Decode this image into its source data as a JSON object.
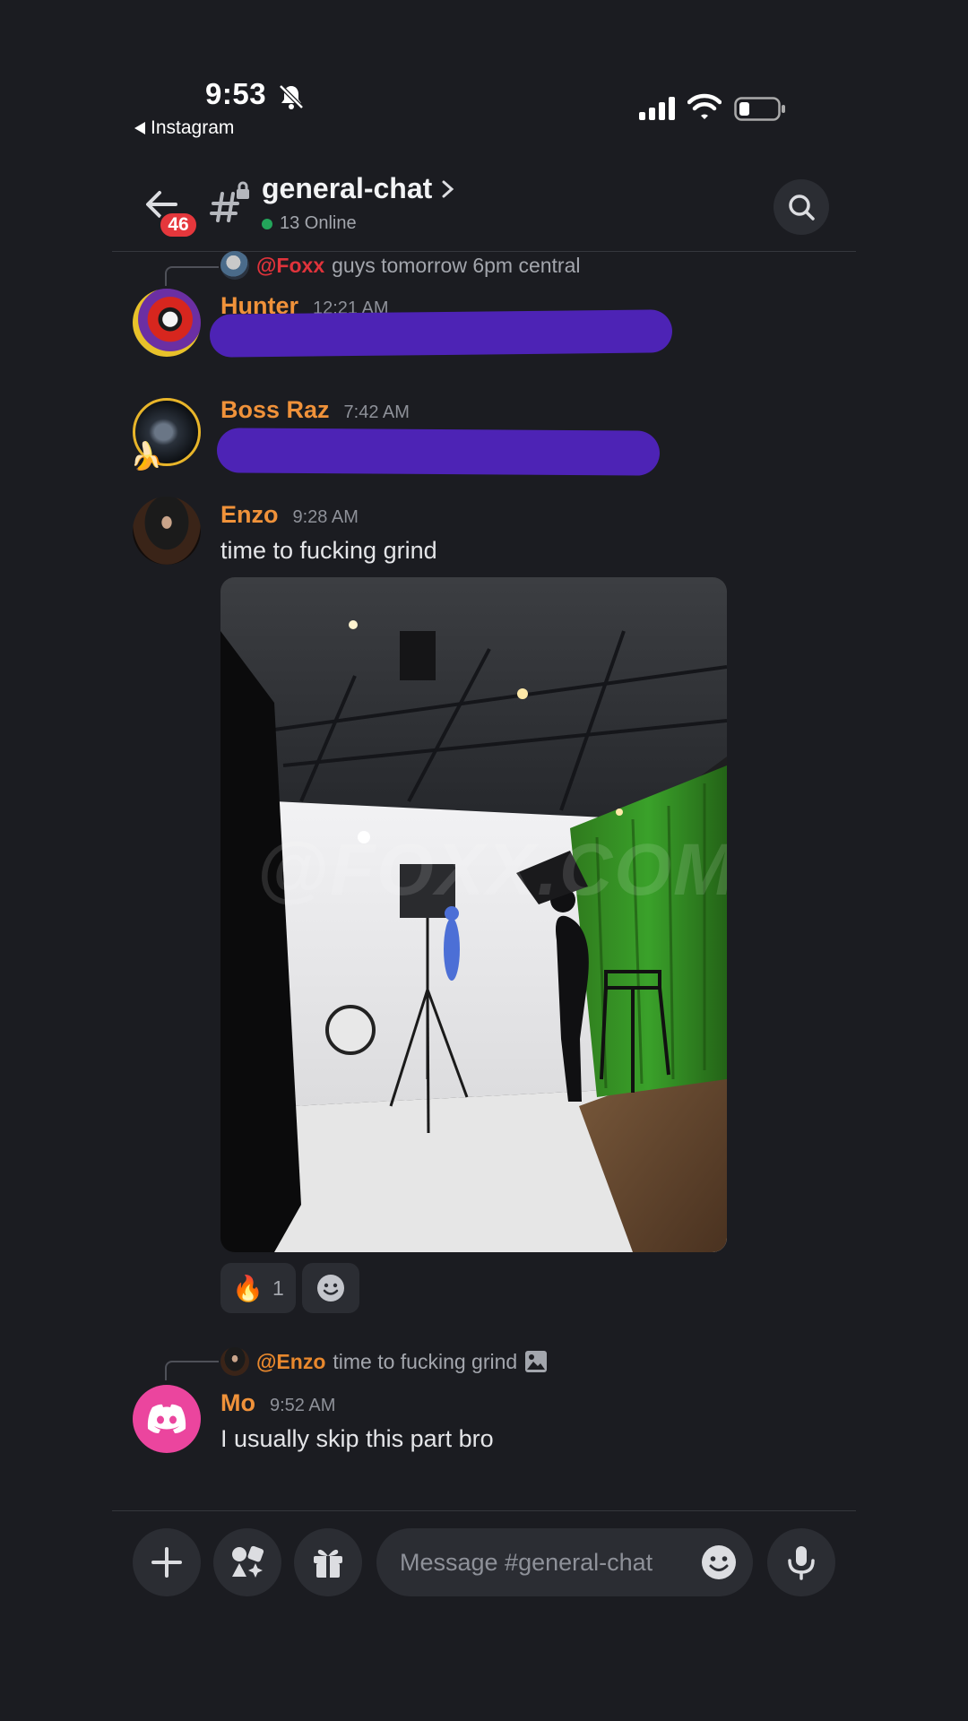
{
  "status_bar": {
    "time": "9:53",
    "back_app": "Instagram"
  },
  "header": {
    "channel_name": "general-chat",
    "online": "13 Online",
    "unread_badge": "46"
  },
  "messages": [
    {
      "reply": {
        "mention": "@Foxx",
        "text": "guys tomorrow 6pm central"
      },
      "author": "Hunter",
      "timestamp": "12:21 AM"
    },
    {
      "author": "Boss Raz",
      "timestamp": "7:42 AM"
    },
    {
      "author": "Enzo",
      "timestamp": "9:28 AM",
      "text": "time to fucking grind",
      "image_watermark": "@FOXX.COM",
      "reactions": [
        {
          "emoji": "🔥",
          "count": "1"
        }
      ]
    },
    {
      "reply": {
        "mention": "@Enzo",
        "text": "time to fucking grind"
      },
      "author": "Mo",
      "timestamp": "9:52 AM",
      "text": "I usually skip this part bro"
    }
  ],
  "composer": {
    "placeholder": "Message #general-chat"
  },
  "colors": {
    "background": "#1b1c21",
    "username": "#f0923a",
    "mention_red": "#e0333b",
    "online_green": "#23a55a",
    "scribble": "#4d23b5"
  },
  "icons": [
    "bell-slash-icon",
    "cellular-signal-icon",
    "wifi-icon",
    "battery-icon",
    "back-arrow-icon",
    "locked-hash-icon",
    "chevron-right-icon",
    "search-icon",
    "plus-icon",
    "apps-icon",
    "gift-icon",
    "emoji-icon",
    "microphone-icon",
    "image-icon",
    "add-reaction-icon"
  ]
}
